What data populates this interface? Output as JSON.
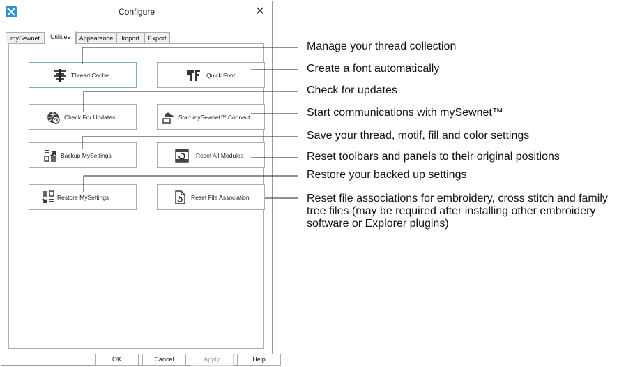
{
  "dialog": {
    "title": "Configure",
    "close_icon": "close-icon",
    "tabs": [
      {
        "label": "mySewnet",
        "active": false
      },
      {
        "label": "Utilities",
        "active": true
      },
      {
        "label": "Appearance",
        "active": false
      },
      {
        "label": "Import",
        "active": false
      },
      {
        "label": "Export",
        "active": false
      }
    ],
    "buttons": {
      "thread_cache": "Thread Cache",
      "quick_font": "Quick Font",
      "check_updates": "Check For Updates",
      "start_connect": "Start mySewnet™ Connect",
      "backup": "Backup MySettings",
      "reset_modules": "Reset All Modules",
      "restore": "Restore MySettings",
      "reset_file_assoc": "Reset File Association"
    },
    "footer": {
      "ok": "OK",
      "cancel": "Cancel",
      "apply": "Apply",
      "help": "Help"
    }
  },
  "callouts": {
    "c1": "Manage your thread collection",
    "c2": "Create a font automatically",
    "c3": "Check for updates",
    "c4": "Start communications with mySewnet™",
    "c5": "Save your thread, motif, fill and color settings",
    "c6": "Reset toolbars and panels to their original positions",
    "c7": "Restore your backed up settings",
    "c8": "Reset file associations for embroidery, cross stitch and family tree files (may be required after installing other embroidery software or Explorer plugins)"
  },
  "colors": {
    "accent_focus": "#6fb8a6",
    "app_icon": "#2f8fd6",
    "disabled_text": "#a0a0a0"
  }
}
